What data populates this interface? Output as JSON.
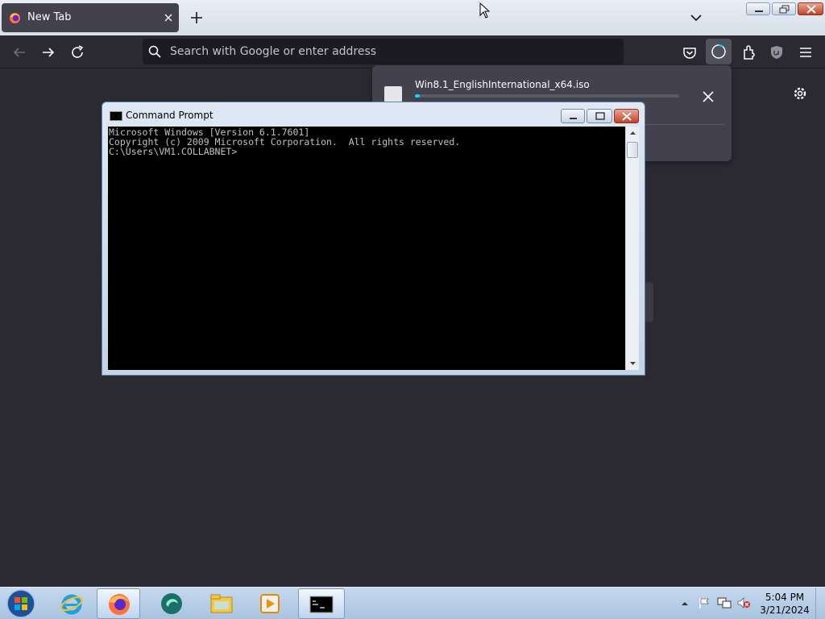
{
  "browser": {
    "tab": {
      "title": "New Tab"
    },
    "urlbar": {
      "placeholder": "Search with Google or enter address"
    }
  },
  "downloads": {
    "items": [
      {
        "filename": "Win8.1_EnglishInternational_x64.iso",
        "progress": 0.01
      }
    ]
  },
  "cmd_window": {
    "title": "Command Prompt",
    "lines": [
      "Microsoft Windows [Version 6.1.7601]",
      "Copyright (c) 2009 Microsoft Corporation.  All rights reserved.",
      "",
      "C:\\Users\\VM1.COLLABNET>"
    ]
  },
  "taskbar": {
    "apps": [
      {
        "name": "internet-explorer-icon"
      },
      {
        "name": "firefox-icon",
        "active": true
      },
      {
        "name": "app-icon"
      },
      {
        "name": "file-explorer-icon"
      },
      {
        "name": "media-player-icon"
      },
      {
        "name": "command-prompt-icon",
        "active": true
      }
    ],
    "clock": {
      "time": "5:04 PM",
      "date": "3/21/2024"
    }
  },
  "colors": {
    "browser_bg": "#2b2a33",
    "urlbar_bg": "#1c1b22",
    "download_progress": "#00ddff",
    "console_bg": "#000000",
    "console_text": "#c0c0c0"
  }
}
